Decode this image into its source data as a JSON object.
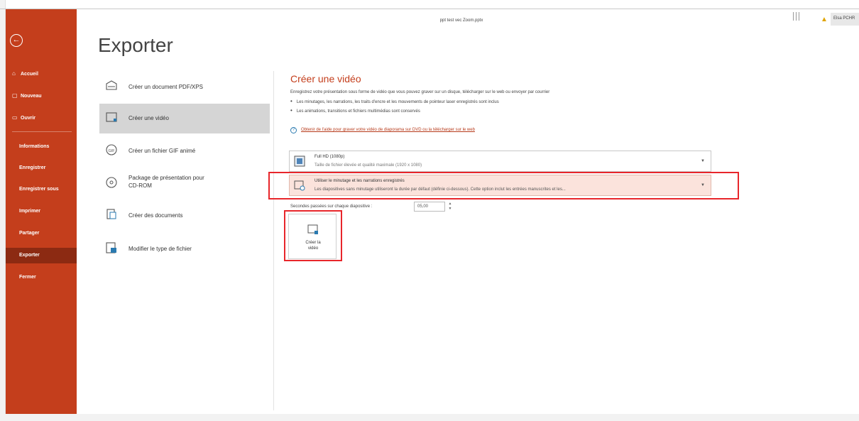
{
  "window": {
    "doc_title": "ppt test vec Zoom.pptx",
    "user_label": "Elsa PCHR"
  },
  "sidebar": {
    "items": [
      {
        "label": "Accueil",
        "icon": "⌂"
      },
      {
        "label": "Nouveau",
        "icon": "▢"
      },
      {
        "label": "Ouvrir",
        "icon": "▭"
      },
      {
        "label": "Informations"
      },
      {
        "label": "Enregistrer"
      },
      {
        "label": "Enregistrer sous"
      },
      {
        "label": "Imprimer"
      },
      {
        "label": "Partager"
      },
      {
        "label": "Exporter"
      },
      {
        "label": "Fermer"
      }
    ]
  },
  "page": {
    "title": "Exporter"
  },
  "export_menu": {
    "items": [
      {
        "label": "Créer un document PDF/XPS"
      },
      {
        "label": "Créer une vidéo"
      },
      {
        "label": "Créer un fichier GIF animé"
      },
      {
        "label": "Package de présentation pour",
        "label2": "CD-ROM"
      },
      {
        "label": "Créer des documents"
      },
      {
        "label": "Modifier le type de fichier"
      }
    ]
  },
  "video_panel": {
    "title": "Créer une vidéo",
    "description": "Enregistrez votre présentation sous forme de vidéo que vous pouvez graver sur un disque, télécharger sur le web ou envoyer par courrier",
    "bullets": [
      "Les minutages, les narrations, les traits d'encre et les mouvements de pointeur laser enregistrés sont inclus",
      "Les animations, transitions et fichiers multimédias sont conservés"
    ],
    "help_link": "Obtenir de l'aide pour graver votre vidéo de diaporama sur DVD ou la télécharger sur le web",
    "quality": {
      "main": "Full HD (1080p)",
      "sub": "Taille de fichier élevée et qualité maximale (1920 x 1080)"
    },
    "timing": {
      "main": "Utiliser le minutage et les narrations enregistrés",
      "sub": "Les diapositives sans minutage utiliseront la durée par défaut (définie ci-dessous). Cette option inclut les entrées manuscrites et les..."
    },
    "seconds_label": "Secondes passées sur chaque diapositive :",
    "seconds_value": "05,00",
    "create_button": {
      "line1": "Créer la",
      "line2": "vidéo"
    }
  },
  "colors": {
    "sidebar": "#c43e1c",
    "sidebar_active": "#8c2a12",
    "accent": "#c43e1c",
    "highlight_box": "#e8262b",
    "link": "#b73a1a"
  }
}
